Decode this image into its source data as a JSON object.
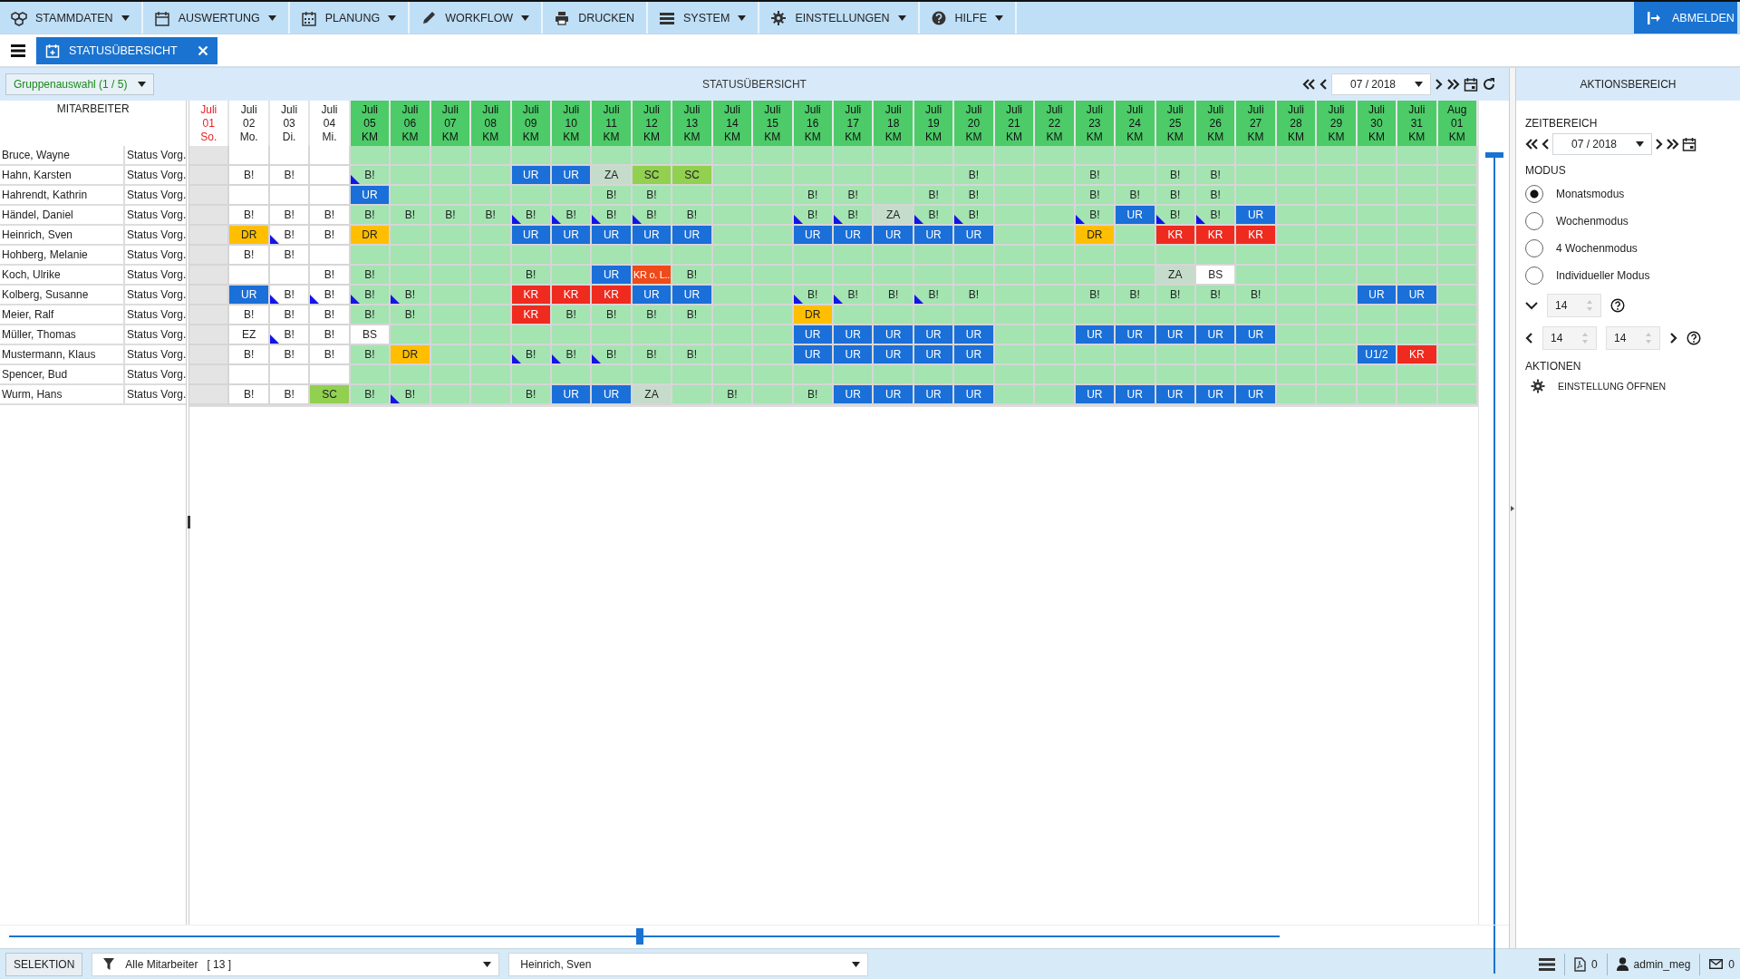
{
  "menu": [
    {
      "label": "STAMMDATEN",
      "dropdown": true
    },
    {
      "label": "AUSWERTUNG",
      "dropdown": true
    },
    {
      "label": "PLANUNG",
      "dropdown": true
    },
    {
      "label": "WORKFLOW",
      "dropdown": true
    },
    {
      "label": "DRUCKEN",
      "dropdown": false
    },
    {
      "label": "SYSTEM",
      "dropdown": true
    },
    {
      "label": "EINSTELLUNGEN",
      "dropdown": true
    },
    {
      "label": "HILFE",
      "dropdown": true
    }
  ],
  "logout": {
    "label": "ABMELDEN"
  },
  "tab": {
    "label": "STATUSÜBERSICHT"
  },
  "toolbar": {
    "group_select": "Gruppenauswahl (1 / 5)",
    "title": "STATUSÜBERSICHT",
    "period": "07 / 2018"
  },
  "employees_header": "MITARBEITER",
  "days": [
    {
      "month": "Juli",
      "day": "01",
      "sub": "So.",
      "kind": "sunday"
    },
    {
      "month": "Juli",
      "day": "02",
      "sub": "Mo.",
      "kind": "normal"
    },
    {
      "month": "Juli",
      "day": "03",
      "sub": "Di.",
      "kind": "normal"
    },
    {
      "month": "Juli",
      "day": "04",
      "sub": "Mi.",
      "kind": "normal"
    },
    {
      "month": "Juli",
      "day": "05",
      "sub": "KM",
      "kind": "km"
    },
    {
      "month": "Juli",
      "day": "06",
      "sub": "KM",
      "kind": "km"
    },
    {
      "month": "Juli",
      "day": "07",
      "sub": "KM",
      "kind": "km"
    },
    {
      "month": "Juli",
      "day": "08",
      "sub": "KM",
      "kind": "km"
    },
    {
      "month": "Juli",
      "day": "09",
      "sub": "KM",
      "kind": "km"
    },
    {
      "month": "Juli",
      "day": "10",
      "sub": "KM",
      "kind": "km"
    },
    {
      "month": "Juli",
      "day": "11",
      "sub": "KM",
      "kind": "km"
    },
    {
      "month": "Juli",
      "day": "12",
      "sub": "KM",
      "kind": "km"
    },
    {
      "month": "Juli",
      "day": "13",
      "sub": "KM",
      "kind": "km"
    },
    {
      "month": "Juli",
      "day": "14",
      "sub": "KM",
      "kind": "km"
    },
    {
      "month": "Juli",
      "day": "15",
      "sub": "KM",
      "kind": "km"
    },
    {
      "month": "Juli",
      "day": "16",
      "sub": "KM",
      "kind": "km"
    },
    {
      "month": "Juli",
      "day": "17",
      "sub": "KM",
      "kind": "km"
    },
    {
      "month": "Juli",
      "day": "18",
      "sub": "KM",
      "kind": "km"
    },
    {
      "month": "Juli",
      "day": "19",
      "sub": "KM",
      "kind": "km"
    },
    {
      "month": "Juli",
      "day": "20",
      "sub": "KM",
      "kind": "km"
    },
    {
      "month": "Juli",
      "day": "21",
      "sub": "KM",
      "kind": "km"
    },
    {
      "month": "Juli",
      "day": "22",
      "sub": "KM",
      "kind": "km"
    },
    {
      "month": "Juli",
      "day": "23",
      "sub": "KM",
      "kind": "km"
    },
    {
      "month": "Juli",
      "day": "24",
      "sub": "KM",
      "kind": "km"
    },
    {
      "month": "Juli",
      "day": "25",
      "sub": "KM",
      "kind": "km"
    },
    {
      "month": "Juli",
      "day": "26",
      "sub": "KM",
      "kind": "km"
    },
    {
      "month": "Juli",
      "day": "27",
      "sub": "KM",
      "kind": "km"
    },
    {
      "month": "Juli",
      "day": "28",
      "sub": "KM",
      "kind": "km"
    },
    {
      "month": "Juli",
      "day": "29",
      "sub": "KM",
      "kind": "km"
    },
    {
      "month": "Juli",
      "day": "30",
      "sub": "KM",
      "kind": "km"
    },
    {
      "month": "Juli",
      "day": "31",
      "sub": "KM",
      "kind": "km"
    },
    {
      "month": "Aug",
      "day": "01",
      "sub": "KM",
      "kind": "km"
    }
  ],
  "rows": [
    {
      "name": "Bruce, Wayne",
      "status": "Status Vorg.",
      "cells": [
        {
          "kind": "empty",
          "flag": false
        },
        {
          "kind": "empty",
          "flag": false
        },
        {
          "kind": "empty",
          "flag": false
        },
        {
          "kind": "empty",
          "flag": false
        },
        {
          "kind": "empty",
          "flag": false
        },
        {
          "kind": "empty",
          "flag": false
        },
        {
          "kind": "empty",
          "flag": false
        },
        {
          "kind": "empty",
          "flag": false
        },
        {
          "kind": "empty",
          "flag": false
        },
        {
          "kind": "empty",
          "flag": false
        },
        {
          "kind": "empty",
          "flag": false
        },
        {
          "kind": "empty",
          "flag": false
        },
        {
          "kind": "empty",
          "flag": false
        },
        {
          "kind": "empty",
          "flag": false
        },
        {
          "kind": "empty",
          "flag": false
        },
        {
          "kind": "empty",
          "flag": false
        },
        {
          "kind": "empty",
          "flag": false
        },
        {
          "kind": "empty",
          "flag": false
        },
        {
          "kind": "empty",
          "flag": false
        },
        {
          "kind": "empty",
          "flag": false
        },
        {
          "kind": "empty",
          "flag": false
        },
        {
          "kind": "empty",
          "flag": false
        },
        {
          "kind": "empty",
          "flag": false
        },
        {
          "kind": "empty",
          "flag": false
        },
        {
          "kind": "empty",
          "flag": false
        },
        {
          "kind": "empty",
          "flag": false
        },
        {
          "kind": "empty",
          "flag": false
        },
        {
          "kind": "empty",
          "flag": false
        },
        {
          "kind": "empty",
          "flag": false
        },
        {
          "kind": "empty",
          "flag": false
        },
        {
          "kind": "empty",
          "flag": false
        },
        {
          "kind": "empty",
          "flag": false
        }
      ]
    },
    {
      "name": "Hahn, Karsten",
      "status": "Status Vorg.",
      "cells": [
        {
          "kind": "empty",
          "flag": false
        },
        {
          "code": "B!",
          "kind": "plain",
          "flag": false
        },
        {
          "code": "B!",
          "kind": "plain",
          "flag": false
        },
        {
          "kind": "empty",
          "flag": false
        },
        {
          "code": "B!",
          "kind": "plain",
          "flag": true
        },
        {
          "kind": "empty",
          "flag": false
        },
        {
          "kind": "empty",
          "flag": false
        },
        {
          "kind": "empty",
          "flag": false
        },
        {
          "code": "UR",
          "kind": "ur",
          "flag": false
        },
        {
          "code": "UR",
          "kind": "ur",
          "flag": false
        },
        {
          "code": "ZA",
          "kind": "za",
          "flag": false
        },
        {
          "code": "SC",
          "kind": "sc",
          "flag": false
        },
        {
          "code": "SC",
          "kind": "sc",
          "flag": false
        },
        {
          "kind": "empty",
          "flag": false
        },
        {
          "kind": "empty",
          "flag": false
        },
        {
          "kind": "empty",
          "flag": false
        },
        {
          "kind": "empty",
          "flag": false
        },
        {
          "kind": "empty",
          "flag": false
        },
        {
          "kind": "empty",
          "flag": false
        },
        {
          "code": "B!",
          "kind": "plain",
          "flag": false
        },
        {
          "kind": "empty",
          "flag": false
        },
        {
          "kind": "empty",
          "flag": false
        },
        {
          "code": "B!",
          "kind": "plain",
          "flag": false
        },
        {
          "kind": "empty",
          "flag": false
        },
        {
          "code": "B!",
          "kind": "plain",
          "flag": false
        },
        {
          "code": "B!",
          "kind": "plain",
          "flag": false
        },
        {
          "kind": "empty",
          "flag": false
        },
        {
          "kind": "empty",
          "flag": false
        },
        {
          "kind": "empty",
          "flag": false
        },
        {
          "kind": "empty",
          "flag": false
        },
        {
          "kind": "empty",
          "flag": false
        },
        {
          "kind": "empty",
          "flag": false
        }
      ]
    },
    {
      "name": "Hahrendt, Kathrin",
      "status": "Status Vorg.",
      "cells": [
        {
          "kind": "empty",
          "flag": false
        },
        {
          "kind": "empty",
          "flag": false
        },
        {
          "kind": "empty",
          "flag": false
        },
        {
          "kind": "empty",
          "flag": false
        },
        {
          "code": "UR",
          "kind": "ur",
          "flag": false
        },
        {
          "kind": "empty",
          "flag": false
        },
        {
          "kind": "empty",
          "flag": false
        },
        {
          "kind": "empty",
          "flag": false
        },
        {
          "kind": "empty",
          "flag": false
        },
        {
          "kind": "empty",
          "flag": false
        },
        {
          "code": "B!",
          "kind": "plain",
          "flag": false
        },
        {
          "code": "B!",
          "kind": "plain",
          "flag": false
        },
        {
          "kind": "empty",
          "flag": false
        },
        {
          "kind": "empty",
          "flag": false
        },
        {
          "kind": "empty",
          "flag": false
        },
        {
          "code": "B!",
          "kind": "plain",
          "flag": false
        },
        {
          "code": "B!",
          "kind": "plain",
          "flag": false
        },
        {
          "kind": "empty",
          "flag": false
        },
        {
          "code": "B!",
          "kind": "plain",
          "flag": false
        },
        {
          "code": "B!",
          "kind": "plain",
          "flag": false
        },
        {
          "kind": "empty",
          "flag": false
        },
        {
          "kind": "empty",
          "flag": false
        },
        {
          "code": "B!",
          "kind": "plain",
          "flag": false
        },
        {
          "code": "B!",
          "kind": "plain",
          "flag": false
        },
        {
          "code": "B!",
          "kind": "plain",
          "flag": false
        },
        {
          "code": "B!",
          "kind": "plain",
          "flag": false
        },
        {
          "kind": "empty",
          "flag": false
        },
        {
          "kind": "empty",
          "flag": false
        },
        {
          "kind": "empty",
          "flag": false
        },
        {
          "kind": "empty",
          "flag": false
        },
        {
          "kind": "empty",
          "flag": false
        },
        {
          "kind": "empty",
          "flag": false
        }
      ]
    },
    {
      "name": "Händel, Daniel",
      "status": "Status Vorg.",
      "cells": [
        {
          "kind": "empty",
          "flag": false
        },
        {
          "code": "B!",
          "kind": "plain",
          "flag": false
        },
        {
          "code": "B!",
          "kind": "plain",
          "flag": false
        },
        {
          "code": "B!",
          "kind": "plain",
          "flag": false
        },
        {
          "code": "B!",
          "kind": "plain",
          "flag": false
        },
        {
          "code": "B!",
          "kind": "plain",
          "flag": false
        },
        {
          "code": "B!",
          "kind": "plain",
          "flag": false
        },
        {
          "code": "B!",
          "kind": "plain",
          "flag": false
        },
        {
          "code": "B!",
          "kind": "plain",
          "flag": true
        },
        {
          "code": "B!",
          "kind": "plain",
          "flag": true
        },
        {
          "code": "B!",
          "kind": "plain",
          "flag": true
        },
        {
          "code": "B!",
          "kind": "plain",
          "flag": true
        },
        {
          "code": "B!",
          "kind": "plain",
          "flag": false
        },
        {
          "kind": "empty",
          "flag": false
        },
        {
          "kind": "empty",
          "flag": false
        },
        {
          "code": "B!",
          "kind": "plain",
          "flag": true
        },
        {
          "code": "B!",
          "kind": "plain",
          "flag": true
        },
        {
          "code": "ZA",
          "kind": "za",
          "flag": false
        },
        {
          "code": "B!",
          "kind": "plain",
          "flag": true
        },
        {
          "code": "B!",
          "kind": "plain",
          "flag": true
        },
        {
          "kind": "empty",
          "flag": false
        },
        {
          "kind": "empty",
          "flag": false
        },
        {
          "code": "B!",
          "kind": "plain",
          "flag": true
        },
        {
          "code": "UR",
          "kind": "ur",
          "flag": false
        },
        {
          "code": "B!",
          "kind": "plain",
          "flag": true
        },
        {
          "code": "B!",
          "kind": "plain",
          "flag": true
        },
        {
          "code": "UR",
          "kind": "ur",
          "flag": false
        },
        {
          "kind": "empty",
          "flag": false
        },
        {
          "kind": "empty",
          "flag": false
        },
        {
          "kind": "empty",
          "flag": false
        },
        {
          "kind": "empty",
          "flag": false
        },
        {
          "kind": "empty",
          "flag": false
        }
      ]
    },
    {
      "name": "Heinrich, Sven",
      "status": "Status Vorg.",
      "cells": [
        {
          "kind": "empty",
          "flag": false
        },
        {
          "code": "DR",
          "kind": "dr",
          "flag": false
        },
        {
          "code": "B!",
          "kind": "plain",
          "flag": true
        },
        {
          "code": "B!",
          "kind": "plain",
          "flag": false
        },
        {
          "code": "DR",
          "kind": "dr",
          "flag": false
        },
        {
          "kind": "empty",
          "flag": false
        },
        {
          "kind": "empty",
          "flag": false
        },
        {
          "kind": "empty",
          "flag": false
        },
        {
          "code": "UR",
          "kind": "ur",
          "flag": false
        },
        {
          "code": "UR",
          "kind": "ur",
          "flag": false
        },
        {
          "code": "UR",
          "kind": "ur",
          "flag": false
        },
        {
          "code": "UR",
          "kind": "ur",
          "flag": false
        },
        {
          "code": "UR",
          "kind": "ur",
          "flag": false
        },
        {
          "kind": "empty",
          "flag": false
        },
        {
          "kind": "empty",
          "flag": false
        },
        {
          "code": "UR",
          "kind": "ur",
          "flag": false
        },
        {
          "code": "UR",
          "kind": "ur",
          "flag": false
        },
        {
          "code": "UR",
          "kind": "ur",
          "flag": false
        },
        {
          "code": "UR",
          "kind": "ur",
          "flag": false
        },
        {
          "code": "UR",
          "kind": "ur",
          "flag": false
        },
        {
          "kind": "empty",
          "flag": false
        },
        {
          "kind": "empty",
          "flag": false
        },
        {
          "code": "DR",
          "kind": "dr",
          "flag": false
        },
        {
          "kind": "empty",
          "flag": false
        },
        {
          "code": "KR",
          "kind": "kr",
          "flag": false
        },
        {
          "code": "KR",
          "kind": "kr",
          "flag": false
        },
        {
          "code": "KR",
          "kind": "kr",
          "flag": false
        },
        {
          "kind": "empty",
          "flag": false
        },
        {
          "kind": "empty",
          "flag": false
        },
        {
          "kind": "empty",
          "flag": false
        },
        {
          "kind": "empty",
          "flag": false
        },
        {
          "kind": "empty",
          "flag": false
        }
      ]
    },
    {
      "name": "Hohberg, Melanie",
      "status": "Status Vorg.",
      "cells": [
        {
          "kind": "empty",
          "flag": false
        },
        {
          "code": "B!",
          "kind": "plain",
          "flag": false
        },
        {
          "code": "B!",
          "kind": "plain",
          "flag": false
        },
        {
          "kind": "empty",
          "flag": false
        },
        {
          "kind": "empty",
          "flag": false
        },
        {
          "kind": "empty",
          "flag": false
        },
        {
          "kind": "empty",
          "flag": false
        },
        {
          "kind": "empty",
          "flag": false
        },
        {
          "kind": "empty",
          "flag": false
        },
        {
          "kind": "empty",
          "flag": false
        },
        {
          "kind": "empty",
          "flag": false
        },
        {
          "kind": "empty",
          "flag": false
        },
        {
          "kind": "empty",
          "flag": false
        },
        {
          "kind": "empty",
          "flag": false
        },
        {
          "kind": "empty",
          "flag": false
        },
        {
          "kind": "empty",
          "flag": false
        },
        {
          "kind": "empty",
          "flag": false
        },
        {
          "kind": "empty",
          "flag": false
        },
        {
          "kind": "empty",
          "flag": false
        },
        {
          "kind": "empty",
          "flag": false
        },
        {
          "kind": "empty",
          "flag": false
        },
        {
          "kind": "empty",
          "flag": false
        },
        {
          "kind": "empty",
          "flag": false
        },
        {
          "kind": "empty",
          "flag": false
        },
        {
          "kind": "empty",
          "flag": false
        },
        {
          "kind": "empty",
          "flag": false
        },
        {
          "kind": "empty",
          "flag": false
        },
        {
          "kind": "empty",
          "flag": false
        },
        {
          "kind": "empty",
          "flag": false
        },
        {
          "kind": "empty",
          "flag": false
        },
        {
          "kind": "empty",
          "flag": false
        },
        {
          "kind": "empty",
          "flag": false
        }
      ]
    },
    {
      "name": "Koch, Ulrike",
      "status": "Status Vorg.",
      "cells": [
        {
          "kind": "empty",
          "flag": false
        },
        {
          "kind": "empty",
          "flag": false
        },
        {
          "kind": "empty",
          "flag": false
        },
        {
          "code": "B!",
          "kind": "plain",
          "flag": false
        },
        {
          "code": "B!",
          "kind": "plain",
          "flag": false
        },
        {
          "kind": "empty",
          "flag": false
        },
        {
          "kind": "empty",
          "flag": false
        },
        {
          "kind": "empty",
          "flag": false
        },
        {
          "code": "B!",
          "kind": "plain",
          "flag": false
        },
        {
          "kind": "empty",
          "flag": false
        },
        {
          "code": "UR",
          "kind": "ur",
          "flag": false
        },
        {
          "code": "KR o. L..",
          "kind": "krol",
          "flag": false
        },
        {
          "code": "B!",
          "kind": "plain",
          "flag": false
        },
        {
          "kind": "empty",
          "flag": false
        },
        {
          "kind": "empty",
          "flag": false
        },
        {
          "kind": "empty",
          "flag": false
        },
        {
          "kind": "empty",
          "flag": false
        },
        {
          "kind": "empty",
          "flag": false
        },
        {
          "kind": "empty",
          "flag": false
        },
        {
          "kind": "empty",
          "flag": false
        },
        {
          "kind": "empty",
          "flag": false
        },
        {
          "kind": "empty",
          "flag": false
        },
        {
          "kind": "empty",
          "flag": false
        },
        {
          "kind": "empty",
          "flag": false
        },
        {
          "code": "ZA",
          "kind": "za",
          "flag": false
        },
        {
          "code": "BS",
          "kind": "bs",
          "flag": false
        },
        {
          "kind": "empty",
          "flag": false
        },
        {
          "kind": "empty",
          "flag": false
        },
        {
          "kind": "empty",
          "flag": false
        },
        {
          "kind": "empty",
          "flag": false
        },
        {
          "kind": "empty",
          "flag": false
        },
        {
          "kind": "empty",
          "flag": false
        }
      ]
    },
    {
      "name": "Kolberg, Susanne",
      "status": "Status Vorg.",
      "cells": [
        {
          "kind": "empty",
          "flag": false
        },
        {
          "code": "UR",
          "kind": "ur",
          "flag": false
        },
        {
          "code": "B!",
          "kind": "plain",
          "flag": true
        },
        {
          "code": "B!",
          "kind": "plain",
          "flag": true
        },
        {
          "code": "B!",
          "kind": "plain",
          "flag": true
        },
        {
          "code": "B!",
          "kind": "plain",
          "flag": true
        },
        {
          "kind": "empty",
          "flag": false
        },
        {
          "kind": "empty",
          "flag": false
        },
        {
          "code": "KR",
          "kind": "kr",
          "flag": false
        },
        {
          "code": "KR",
          "kind": "kr",
          "flag": false
        },
        {
          "code": "KR",
          "kind": "kr",
          "flag": false
        },
        {
          "code": "UR",
          "kind": "ur",
          "flag": false
        },
        {
          "code": "UR",
          "kind": "ur",
          "flag": false
        },
        {
          "kind": "empty",
          "flag": false
        },
        {
          "kind": "empty",
          "flag": false
        },
        {
          "code": "B!",
          "kind": "plain",
          "flag": true
        },
        {
          "code": "B!",
          "kind": "plain",
          "flag": true
        },
        {
          "code": "B!",
          "kind": "plain",
          "flag": false
        },
        {
          "code": "B!",
          "kind": "plain",
          "flag": true
        },
        {
          "code": "B!",
          "kind": "plain",
          "flag": false
        },
        {
          "kind": "empty",
          "flag": false
        },
        {
          "kind": "empty",
          "flag": false
        },
        {
          "code": "B!",
          "kind": "plain",
          "flag": false
        },
        {
          "code": "B!",
          "kind": "plain",
          "flag": false
        },
        {
          "code": "B!",
          "kind": "plain",
          "flag": false
        },
        {
          "code": "B!",
          "kind": "plain",
          "flag": false
        },
        {
          "code": "B!",
          "kind": "plain",
          "flag": false
        },
        {
          "kind": "empty",
          "flag": false
        },
        {
          "kind": "empty",
          "flag": false
        },
        {
          "code": "UR",
          "kind": "ur",
          "flag": false
        },
        {
          "code": "UR",
          "kind": "ur",
          "flag": false
        },
        {
          "kind": "empty",
          "flag": false
        }
      ]
    },
    {
      "name": "Meier, Ralf",
      "status": "Status Vorg.",
      "cells": [
        {
          "kind": "empty",
          "flag": false
        },
        {
          "code": "B!",
          "kind": "plain",
          "flag": false
        },
        {
          "code": "B!",
          "kind": "plain",
          "flag": false
        },
        {
          "code": "B!",
          "kind": "plain",
          "flag": false
        },
        {
          "code": "B!",
          "kind": "plain",
          "flag": false
        },
        {
          "code": "B!",
          "kind": "plain",
          "flag": false
        },
        {
          "kind": "empty",
          "flag": false
        },
        {
          "kind": "empty",
          "flag": false
        },
        {
          "code": "KR",
          "kind": "kr",
          "flag": false
        },
        {
          "code": "B!",
          "kind": "plain",
          "flag": false
        },
        {
          "code": "B!",
          "kind": "plain",
          "flag": false
        },
        {
          "code": "B!",
          "kind": "plain",
          "flag": false
        },
        {
          "code": "B!",
          "kind": "plain",
          "flag": false
        },
        {
          "kind": "empty",
          "flag": false
        },
        {
          "kind": "empty",
          "flag": false
        },
        {
          "code": "DR",
          "kind": "dr",
          "flag": false
        },
        {
          "kind": "empty",
          "flag": false
        },
        {
          "kind": "empty",
          "flag": false
        },
        {
          "kind": "empty",
          "flag": false
        },
        {
          "kind": "empty",
          "flag": false
        },
        {
          "kind": "empty",
          "flag": false
        },
        {
          "kind": "empty",
          "flag": false
        },
        {
          "kind": "empty",
          "flag": false
        },
        {
          "kind": "empty",
          "flag": false
        },
        {
          "kind": "empty",
          "flag": false
        },
        {
          "kind": "empty",
          "flag": false
        },
        {
          "kind": "empty",
          "flag": false
        },
        {
          "kind": "empty",
          "flag": false
        },
        {
          "kind": "empty",
          "flag": false
        },
        {
          "kind": "empty",
          "flag": false
        },
        {
          "kind": "empty",
          "flag": false
        },
        {
          "kind": "empty",
          "flag": false
        }
      ]
    },
    {
      "name": "Müller, Thomas",
      "status": "Status Vorg.",
      "cells": [
        {
          "kind": "empty",
          "flag": false
        },
        {
          "code": "EZ",
          "kind": "plain",
          "flag": false
        },
        {
          "code": "B!",
          "kind": "plain",
          "flag": true
        },
        {
          "code": "B!",
          "kind": "plain",
          "flag": false
        },
        {
          "code": "BS",
          "kind": "bs",
          "flag": false
        },
        {
          "kind": "empty",
          "flag": false
        },
        {
          "kind": "empty",
          "flag": false
        },
        {
          "kind": "empty",
          "flag": false
        },
        {
          "kind": "empty",
          "flag": false
        },
        {
          "kind": "empty",
          "flag": false
        },
        {
          "kind": "empty",
          "flag": false
        },
        {
          "kind": "empty",
          "flag": false
        },
        {
          "kind": "empty",
          "flag": false
        },
        {
          "kind": "empty",
          "flag": false
        },
        {
          "kind": "empty",
          "flag": false
        },
        {
          "code": "UR",
          "kind": "ur",
          "flag": false
        },
        {
          "code": "UR",
          "kind": "ur",
          "flag": false
        },
        {
          "code": "UR",
          "kind": "ur",
          "flag": false
        },
        {
          "code": "UR",
          "kind": "ur",
          "flag": false
        },
        {
          "code": "UR",
          "kind": "ur",
          "flag": false
        },
        {
          "kind": "empty",
          "flag": false
        },
        {
          "kind": "empty",
          "flag": false
        },
        {
          "code": "UR",
          "kind": "ur",
          "flag": false
        },
        {
          "code": "UR",
          "kind": "ur",
          "flag": false
        },
        {
          "code": "UR",
          "kind": "ur",
          "flag": false
        },
        {
          "code": "UR",
          "kind": "ur",
          "flag": false
        },
        {
          "code": "UR",
          "kind": "ur",
          "flag": false
        },
        {
          "kind": "empty",
          "flag": false
        },
        {
          "kind": "empty",
          "flag": false
        },
        {
          "kind": "empty",
          "flag": false
        },
        {
          "kind": "empty",
          "flag": false
        },
        {
          "kind": "empty",
          "flag": false
        }
      ]
    },
    {
      "name": "Mustermann, Klaus",
      "status": "Status Vorg.",
      "cells": [
        {
          "kind": "empty",
          "flag": false
        },
        {
          "code": "B!",
          "kind": "plain",
          "flag": false
        },
        {
          "code": "B!",
          "kind": "plain",
          "flag": false
        },
        {
          "code": "B!",
          "kind": "plain",
          "flag": false
        },
        {
          "code": "B!",
          "kind": "plain",
          "flag": false
        },
        {
          "code": "DR",
          "kind": "dr",
          "flag": false
        },
        {
          "kind": "empty",
          "flag": false
        },
        {
          "kind": "empty",
          "flag": false
        },
        {
          "code": "B!",
          "kind": "plain",
          "flag": true
        },
        {
          "code": "B!",
          "kind": "plain",
          "flag": true
        },
        {
          "code": "B!",
          "kind": "plain",
          "flag": true
        },
        {
          "code": "B!",
          "kind": "plain",
          "flag": false
        },
        {
          "code": "B!",
          "kind": "plain",
          "flag": false
        },
        {
          "kind": "empty",
          "flag": false
        },
        {
          "kind": "empty",
          "flag": false
        },
        {
          "code": "UR",
          "kind": "ur",
          "flag": false
        },
        {
          "code": "UR",
          "kind": "ur",
          "flag": false
        },
        {
          "code": "UR",
          "kind": "ur",
          "flag": false
        },
        {
          "code": "UR",
          "kind": "ur",
          "flag": false
        },
        {
          "code": "UR",
          "kind": "ur",
          "flag": false
        },
        {
          "kind": "empty",
          "flag": false
        },
        {
          "kind": "empty",
          "flag": false
        },
        {
          "kind": "empty",
          "flag": false
        },
        {
          "kind": "empty",
          "flag": false
        },
        {
          "kind": "empty",
          "flag": false
        },
        {
          "kind": "empty",
          "flag": false
        },
        {
          "kind": "empty",
          "flag": false
        },
        {
          "kind": "empty",
          "flag": false
        },
        {
          "kind": "empty",
          "flag": false
        },
        {
          "code": "U1/2",
          "kind": "ur",
          "flag": false
        },
        {
          "code": "KR",
          "kind": "kr",
          "flag": false
        },
        {
          "kind": "empty",
          "flag": false
        }
      ]
    },
    {
      "name": "Spencer, Bud",
      "status": "Status Vorg.",
      "cells": [
        {
          "kind": "empty",
          "flag": false
        },
        {
          "kind": "empty",
          "flag": false
        },
        {
          "kind": "empty",
          "flag": false
        },
        {
          "kind": "empty",
          "flag": false
        },
        {
          "kind": "empty",
          "flag": false
        },
        {
          "kind": "empty",
          "flag": false
        },
        {
          "kind": "empty",
          "flag": false
        },
        {
          "kind": "empty",
          "flag": false
        },
        {
          "kind": "empty",
          "flag": false
        },
        {
          "kind": "empty",
          "flag": false
        },
        {
          "kind": "empty",
          "flag": false
        },
        {
          "kind": "empty",
          "flag": false
        },
        {
          "kind": "empty",
          "flag": false
        },
        {
          "kind": "empty",
          "flag": false
        },
        {
          "kind": "empty",
          "flag": false
        },
        {
          "kind": "empty",
          "flag": false
        },
        {
          "kind": "empty",
          "flag": false
        },
        {
          "kind": "empty",
          "flag": false
        },
        {
          "kind": "empty",
          "flag": false
        },
        {
          "kind": "empty",
          "flag": false
        },
        {
          "kind": "empty",
          "flag": false
        },
        {
          "kind": "empty",
          "flag": false
        },
        {
          "kind": "empty",
          "flag": false
        },
        {
          "kind": "empty",
          "flag": false
        },
        {
          "kind": "empty",
          "flag": false
        },
        {
          "kind": "empty",
          "flag": false
        },
        {
          "kind": "empty",
          "flag": false
        },
        {
          "kind": "empty",
          "flag": false
        },
        {
          "kind": "empty",
          "flag": false
        },
        {
          "kind": "empty",
          "flag": false
        },
        {
          "kind": "empty",
          "flag": false
        },
        {
          "kind": "empty",
          "flag": false
        }
      ]
    },
    {
      "name": "Wurm, Hans",
      "status": "Status Vorg.",
      "cells": [
        {
          "kind": "empty",
          "flag": false
        },
        {
          "code": "B!",
          "kind": "plain",
          "flag": false
        },
        {
          "code": "B!",
          "kind": "plain",
          "flag": false
        },
        {
          "code": "SC",
          "kind": "sc",
          "flag": false
        },
        {
          "code": "B!",
          "kind": "plain",
          "flag": false
        },
        {
          "code": "B!",
          "kind": "plain",
          "flag": true
        },
        {
          "kind": "empty",
          "flag": false
        },
        {
          "kind": "empty",
          "flag": false
        },
        {
          "code": "B!",
          "kind": "plain",
          "flag": false
        },
        {
          "code": "UR",
          "kind": "ur",
          "flag": false
        },
        {
          "code": "UR",
          "kind": "ur",
          "flag": false
        },
        {
          "code": "ZA",
          "kind": "za",
          "flag": false
        },
        {
          "kind": "empty",
          "flag": false
        },
        {
          "code": "B!",
          "kind": "plain",
          "flag": false
        },
        {
          "kind": "empty",
          "flag": false
        },
        {
          "code": "B!",
          "kind": "plain",
          "flag": false
        },
        {
          "code": "UR",
          "kind": "ur",
          "flag": false
        },
        {
          "code": "UR",
          "kind": "ur",
          "flag": false
        },
        {
          "code": "UR",
          "kind": "ur",
          "flag": false
        },
        {
          "code": "UR",
          "kind": "ur",
          "flag": false
        },
        {
          "kind": "empty",
          "flag": false
        },
        {
          "kind": "empty",
          "flag": false
        },
        {
          "code": "UR",
          "kind": "ur",
          "flag": false
        },
        {
          "code": "UR",
          "kind": "ur",
          "flag": false
        },
        {
          "code": "UR",
          "kind": "ur",
          "flag": false
        },
        {
          "code": "UR",
          "kind": "ur",
          "flag": false
        },
        {
          "code": "UR",
          "kind": "ur",
          "flag": false
        },
        {
          "kind": "empty",
          "flag": false
        },
        {
          "kind": "empty",
          "flag": false
        },
        {
          "kind": "empty",
          "flag": false
        },
        {
          "kind": "empty",
          "flag": false
        },
        {
          "kind": "empty",
          "flag": false
        }
      ]
    }
  ],
  "action_panel": {
    "title": "AKTIONSBEREICH",
    "period_label": "ZEITBEREICH",
    "period": "07 / 2018",
    "mode_label": "MODUS",
    "modes": [
      {
        "label": "Monatsmodus",
        "selected": true
      },
      {
        "label": "Wochenmodus",
        "selected": false
      },
      {
        "label": "4 Wochenmodus",
        "selected": false
      },
      {
        "label": "Individueller Modus",
        "selected": false
      }
    ],
    "count": "14",
    "range_from": "14",
    "range_to": "14",
    "actions_label": "AKTIONEN",
    "actions": [
      "EINSTELLUNG ÖFFNEN"
    ]
  },
  "status_bar": {
    "selection": "SELEKTION",
    "filter": "Alle Mitarbeiter   [ 13 ]",
    "employee": "Heinrich, Sven",
    "pdf_count": "0",
    "user": "admin_meg",
    "mail_count": "0"
  }
}
